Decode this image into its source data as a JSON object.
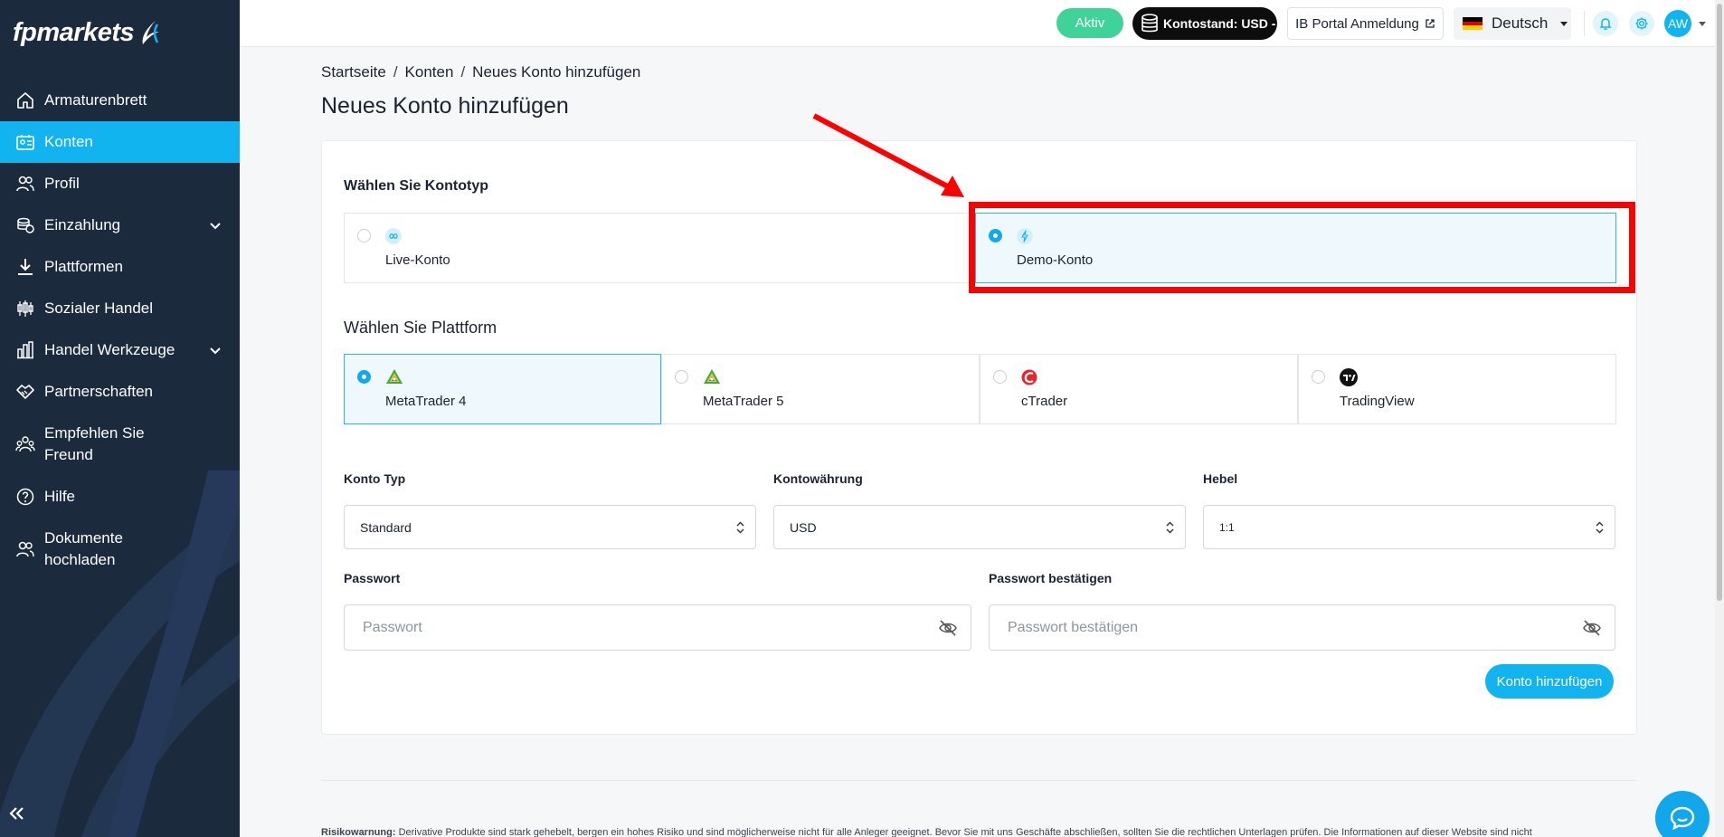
{
  "brand": {
    "name": "fpmarkets",
    "accent": "#12b4f0",
    "sidebar_bg": "#1c2a3e"
  },
  "sidebar": {
    "items": [
      {
        "label": "Armaturenbrett",
        "icon": "home-icon"
      },
      {
        "label": "Konten",
        "icon": "accounts-icon",
        "active": true
      },
      {
        "label": "Profil",
        "icon": "users-icon"
      },
      {
        "label": "Einzahlung",
        "icon": "coins-icon",
        "expandable": true
      },
      {
        "label": "Plattformen",
        "icon": "download-icon"
      },
      {
        "label": "Sozialer Handel",
        "icon": "candles-icon"
      },
      {
        "label": "Handel Werkzeuge",
        "icon": "chart-icon",
        "expandable": true
      },
      {
        "label": "Partnerschaften",
        "icon": "handshake-icon"
      },
      {
        "label": "Empfehlen Sie Freund",
        "icon": "referral-icon"
      },
      {
        "label": "Hilfe",
        "icon": "help-icon"
      },
      {
        "label": "Dokumente hochladen",
        "icon": "upload-docs-icon"
      }
    ],
    "collapse_icon": "double-chevron-left-icon"
  },
  "topbar": {
    "status": "Aktiv",
    "balance": "Kontostand: USD -",
    "ib_portal": "IB Portal Anmeldung",
    "language": "Deutsch",
    "avatar": "AW"
  },
  "breadcrumb": {
    "home": "Startseite",
    "accounts": "Konten",
    "current": "Neues Konto hinzufügen"
  },
  "page_title": "Neues Konto hinzufügen",
  "account_type": {
    "heading": "Wählen Sie Kontotyp",
    "options": [
      {
        "label": "Live-Konto",
        "selected": false
      },
      {
        "label": "Demo-Konto",
        "selected": true
      }
    ]
  },
  "platform": {
    "heading": "Wählen Sie Plattform",
    "options": [
      {
        "label": "MetaTrader 4",
        "selected": true
      },
      {
        "label": "MetaTrader 5",
        "selected": false
      },
      {
        "label": "cTrader",
        "selected": false
      },
      {
        "label": "TradingView",
        "selected": false
      }
    ]
  },
  "form": {
    "konto_typ": {
      "label": "Konto Typ",
      "value": "Standard"
    },
    "waehrung": {
      "label": "Kontowährung",
      "value": "USD"
    },
    "hebel": {
      "label": "Hebel",
      "value": "1:1"
    },
    "passwort": {
      "label": "Passwort",
      "placeholder": "Passwort"
    },
    "passwort_confirm": {
      "label": "Passwort bestätigen",
      "placeholder": "Passwort bestätigen"
    },
    "submit": "Konto hinzufügen"
  },
  "footer": {
    "risk_title": "Risikowarnung:",
    "risk_text": "Derivative Produkte sind stark gehebelt, bergen ein hohes Risiko und sind möglicherweise nicht für alle Anleger geeignet. Bevor Sie mit uns Geschäfte abschließen, sollten Sie die rechtlichen Unterlagen prüfen. Die Informationen auf dieser Website sind nicht"
  },
  "annotation": {
    "color": "#ff0000"
  }
}
